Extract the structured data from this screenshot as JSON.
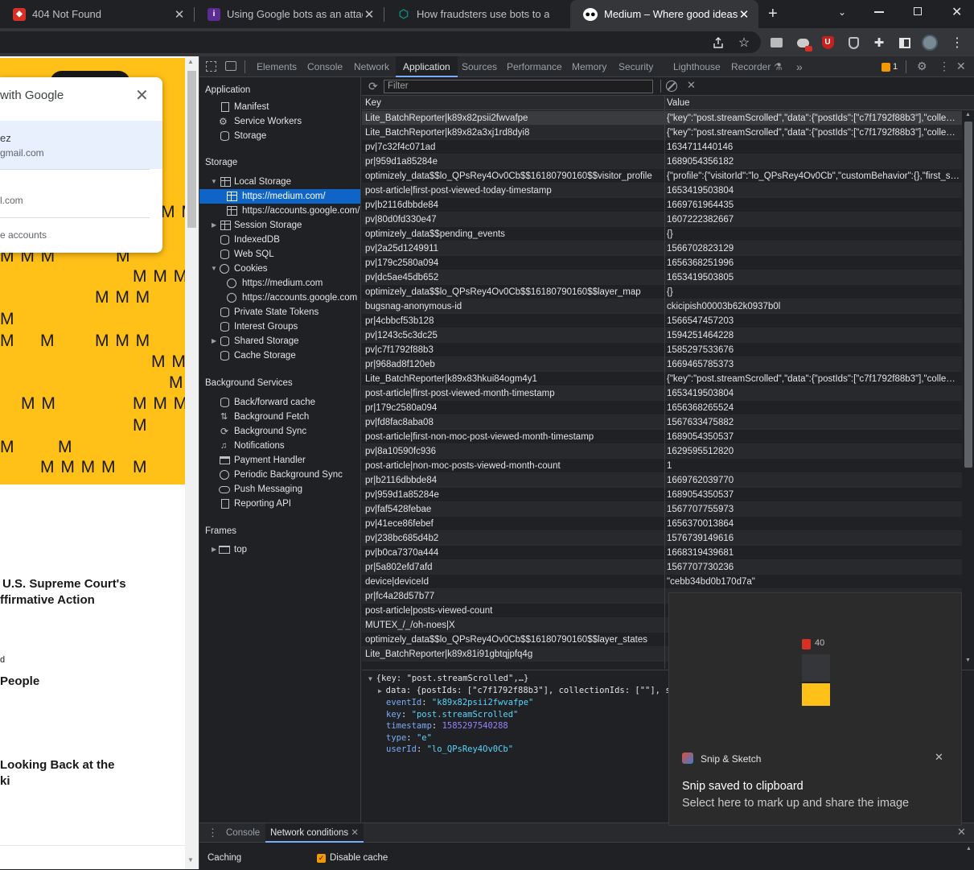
{
  "browser": {
    "tabs": [
      {
        "title": "404 Not Found",
        "favicon_color": "#d93025"
      },
      {
        "title": "Using Google bots as an attack v",
        "favicon_color": "#5c2d91"
      },
      {
        "title": "How fraudsters use bots to attac",
        "favicon_color": "#0e8c7d"
      },
      {
        "title": "Medium – Where good ideas fin",
        "favicon_color": "#000000"
      }
    ],
    "new_tab_icon": "plus-icon"
  },
  "page": {
    "google_popup": {
      "title": "with Google",
      "account_name": "ez",
      "account_email": "gmail.com",
      "second_email": "l.com",
      "more_accounts": "e accounts"
    },
    "articles": [
      {
        "line1": "U.S. Supreme Court's",
        "line2": "ffirmative Action"
      },
      {
        "line1": "d",
        "line2": ""
      },
      {
        "line1": "People",
        "line2": ""
      },
      {
        "line1": "Looking Back at the",
        "line2": "ki"
      }
    ]
  },
  "devtools": {
    "tabs": [
      "Elements",
      "Console",
      "Network",
      "Application",
      "Sources",
      "Performance",
      "Memory",
      "Security",
      "Lighthouse",
      "Recorder"
    ],
    "active_tab": "Application",
    "issues_count": "1",
    "sidebar": {
      "application_header": "Application",
      "application_items": [
        "Manifest",
        "Service Workers",
        "Storage"
      ],
      "storage_header": "Storage",
      "local_storage": "Local Storage",
      "local_storage_children": [
        "https://medium.com/",
        "https://accounts.google.com/"
      ],
      "session_storage": "Session Storage",
      "indexeddb": "IndexedDB",
      "websql": "Web SQL",
      "cookies": "Cookies",
      "cookies_children": [
        "https://medium.com",
        "https://accounts.google.com"
      ],
      "private_state_tokens": "Private State Tokens",
      "interest_groups": "Interest Groups",
      "shared_storage": "Shared Storage",
      "cache_storage": "Cache Storage",
      "background_header": "Background Services",
      "background_items": [
        "Back/forward cache",
        "Background Fetch",
        "Background Sync",
        "Notifications",
        "Payment Handler",
        "Periodic Background Sync",
        "Push Messaging",
        "Reporting API"
      ],
      "frames_header": "Frames",
      "frames_top": "top"
    },
    "filter_placeholder": "Filter",
    "table": {
      "col_key": "Key",
      "col_value": "Value",
      "rows": [
        {
          "key": "Lite_BatchReporter|k89x82psii2fwvafpe",
          "value": "{\"key\":\"post.streamScrolled\",\"data\":{\"postIds\":[\"c7f1792f88b3\"],\"collectionId..."
        },
        {
          "key": "Lite_BatchReporter|k89x82a3xj1rd8dyi8",
          "value": "{\"key\":\"post.streamScrolled\",\"data\":{\"postIds\":[\"c7f1792f88b3\"],\"collectionId..."
        },
        {
          "key": "pv|7c32f4c071ad",
          "value": "1634711440146"
        },
        {
          "key": "pr|959d1a85284e",
          "value": "1689054356182"
        },
        {
          "key": "optimizely_data$$lo_QPsRey4Ov0Cb$$16180790160$$visitor_profile",
          "value": "{\"profile\":{\"visitorId\":\"lo_QPsRey4Ov0Cb\",\"customBehavior\":{},\"first_session\":..."
        },
        {
          "key": "post-article|first-post-viewed-today-timestamp",
          "value": "1653419503804"
        },
        {
          "key": "pv|b2116dbbde84",
          "value": "1669761964435"
        },
        {
          "key": "pv|80d0fd330e47",
          "value": "1607222382667"
        },
        {
          "key": "optimizely_data$$pending_events",
          "value": "{}"
        },
        {
          "key": "pv|2a25d1249911",
          "value": "1566702823129"
        },
        {
          "key": "pv|179c2580a094",
          "value": "1656368251996"
        },
        {
          "key": "pv|dc5ae45db652",
          "value": "1653419503805"
        },
        {
          "key": "optimizely_data$$lo_QPsRey4Ov0Cb$$16180790160$$layer_map",
          "value": "{}"
        },
        {
          "key": "bugsnag-anonymous-id",
          "value": "ckicipish00003b62k0937b0l"
        },
        {
          "key": "pr|4cbbcf53b128",
          "value": "1566547457203"
        },
        {
          "key": "pv|1243c5c3dc25",
          "value": "1594251464228"
        },
        {
          "key": "pv|c7f1792f88b3",
          "value": "1585297533676"
        },
        {
          "key": "pr|968ad8f120eb",
          "value": "1669465785373"
        },
        {
          "key": "Lite_BatchReporter|k89x83hkui84ogm4y1",
          "value": "{\"key\":\"post.streamScrolled\",\"data\":{\"postIds\":[\"c7f1792f88b3\"],\"collectionId..."
        },
        {
          "key": "post-article|first-post-viewed-month-timestamp",
          "value": "1653419503804"
        },
        {
          "key": "pr|179c2580a094",
          "value": "1656368265524"
        },
        {
          "key": "pv|fd8fac8aba08",
          "value": "1567633475882"
        },
        {
          "key": "post-article|first-non-moc-post-viewed-month-timestamp",
          "value": "1689054350537"
        },
        {
          "key": "pv|8a10590fc936",
          "value": "1629595512820"
        },
        {
          "key": "post-article|non-moc-posts-viewed-month-count",
          "value": "1"
        },
        {
          "key": "pr|b2116dbbde84",
          "value": "1669762039770"
        },
        {
          "key": "pv|959d1a85284e",
          "value": "1689054350537"
        },
        {
          "key": "pv|faf5428febae",
          "value": "1567707755973"
        },
        {
          "key": "pv|41ece86febef",
          "value": "1656370013864"
        },
        {
          "key": "pv|238bc685d4b2",
          "value": "1576739149616"
        },
        {
          "key": "pv|b0ca7370a444",
          "value": "1668319439681"
        },
        {
          "key": "pr|5a802efd7afd",
          "value": "1567707730236"
        },
        {
          "key": "device|deviceId",
          "value": "\"cebb34bd0b170d7a\""
        },
        {
          "key": "pr|fc4a28d57b77",
          "value": ""
        },
        {
          "key": "post-article|posts-viewed-count",
          "value": ""
        },
        {
          "key": "MUTEX_/_/oh-noes|X",
          "value": ""
        },
        {
          "key": "optimizely_data$$lo_QPsRey4Ov0Cb$$16180790160$$layer_states",
          "value": ""
        },
        {
          "key": "Lite_BatchReporter|k89x81i91gbtqjpfq4g",
          "value": ""
        }
      ]
    },
    "preview": {
      "summary": "{key: \"post.streamScrolled\",…}",
      "data_line": "data: {postIds: [\"c7f1792f88b3\"], collectionIds: [\"\"], sequ",
      "props": [
        {
          "k": "eventId",
          "v": "\"k89x82psii2fwvafpe\"",
          "kind": "string"
        },
        {
          "k": "key",
          "v": "\"post.streamScrolled\"",
          "kind": "string"
        },
        {
          "k": "timestamp",
          "v": "1585297540288",
          "kind": "number"
        },
        {
          "k": "type",
          "v": "\"e\"",
          "kind": "string"
        },
        {
          "k": "userId",
          "v": "\"lo_QPsRey4Ov0Cb\"",
          "kind": "string"
        }
      ]
    },
    "drawer": {
      "tabs": [
        "Console",
        "Network conditions"
      ],
      "active": "Network conditions",
      "caching_label": "Caching",
      "disable_cache_label": "Disable cache",
      "disable_cache_checked": true
    }
  },
  "toast": {
    "app_name": "Snip & Sketch",
    "title": "Snip saved to clipboard",
    "body": "Select here to mark up and share the image",
    "thumb_text": "40"
  }
}
